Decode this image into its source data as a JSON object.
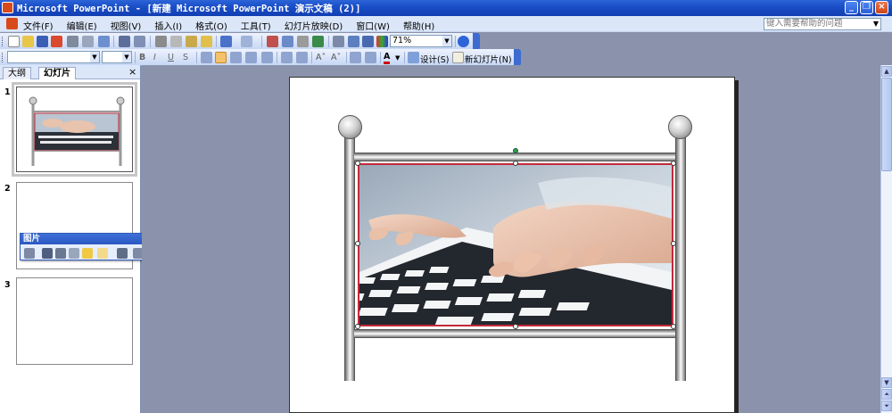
{
  "window": {
    "title": "Microsoft PowerPoint - [新建 Microsoft PowerPoint 演示文稿 (2)]",
    "minimize": "_",
    "restore": "❐",
    "close": "×"
  },
  "menu": {
    "items": [
      "文件(F)",
      "编辑(E)",
      "视图(V)",
      "插入(I)",
      "格式(O)",
      "工具(T)",
      "幻灯片放映(D)",
      "窗口(W)",
      "帮助(H)"
    ],
    "help_placeholder": "键入需要帮助的问题"
  },
  "standard_toolbar": {
    "zoom": "71%"
  },
  "format_toolbar": {
    "font_name": "",
    "font_size": "",
    "design_label": "设计(S)",
    "new_slide_label": "新幻灯片(N)"
  },
  "left_pane": {
    "tabs": [
      "大纲",
      "幻灯片"
    ],
    "close": "×",
    "slides": [
      "1",
      "2",
      "3"
    ]
  },
  "picture_toolbar": {
    "title": "图片",
    "dropdown": "▾",
    "close": "×"
  },
  "colors": {
    "titlebar": "#1a4fc8",
    "photo_border": "#c22a3b",
    "workspace": "#8a93ab"
  },
  "icons": [
    "app-icon",
    "new-icon",
    "open-icon",
    "save-icon",
    "print-icon",
    "cut-icon",
    "copy-icon",
    "paste-icon",
    "undo-icon",
    "redo-icon",
    "chart-icon",
    "table-icon",
    "help-icon",
    "bold-icon",
    "italic-icon",
    "underline-icon",
    "shadow-icon",
    "align-left-icon",
    "align-center-icon",
    "align-right-icon",
    "font-color-icon",
    "insert-picture-icon",
    "crop-icon",
    "rotate-icon"
  ]
}
